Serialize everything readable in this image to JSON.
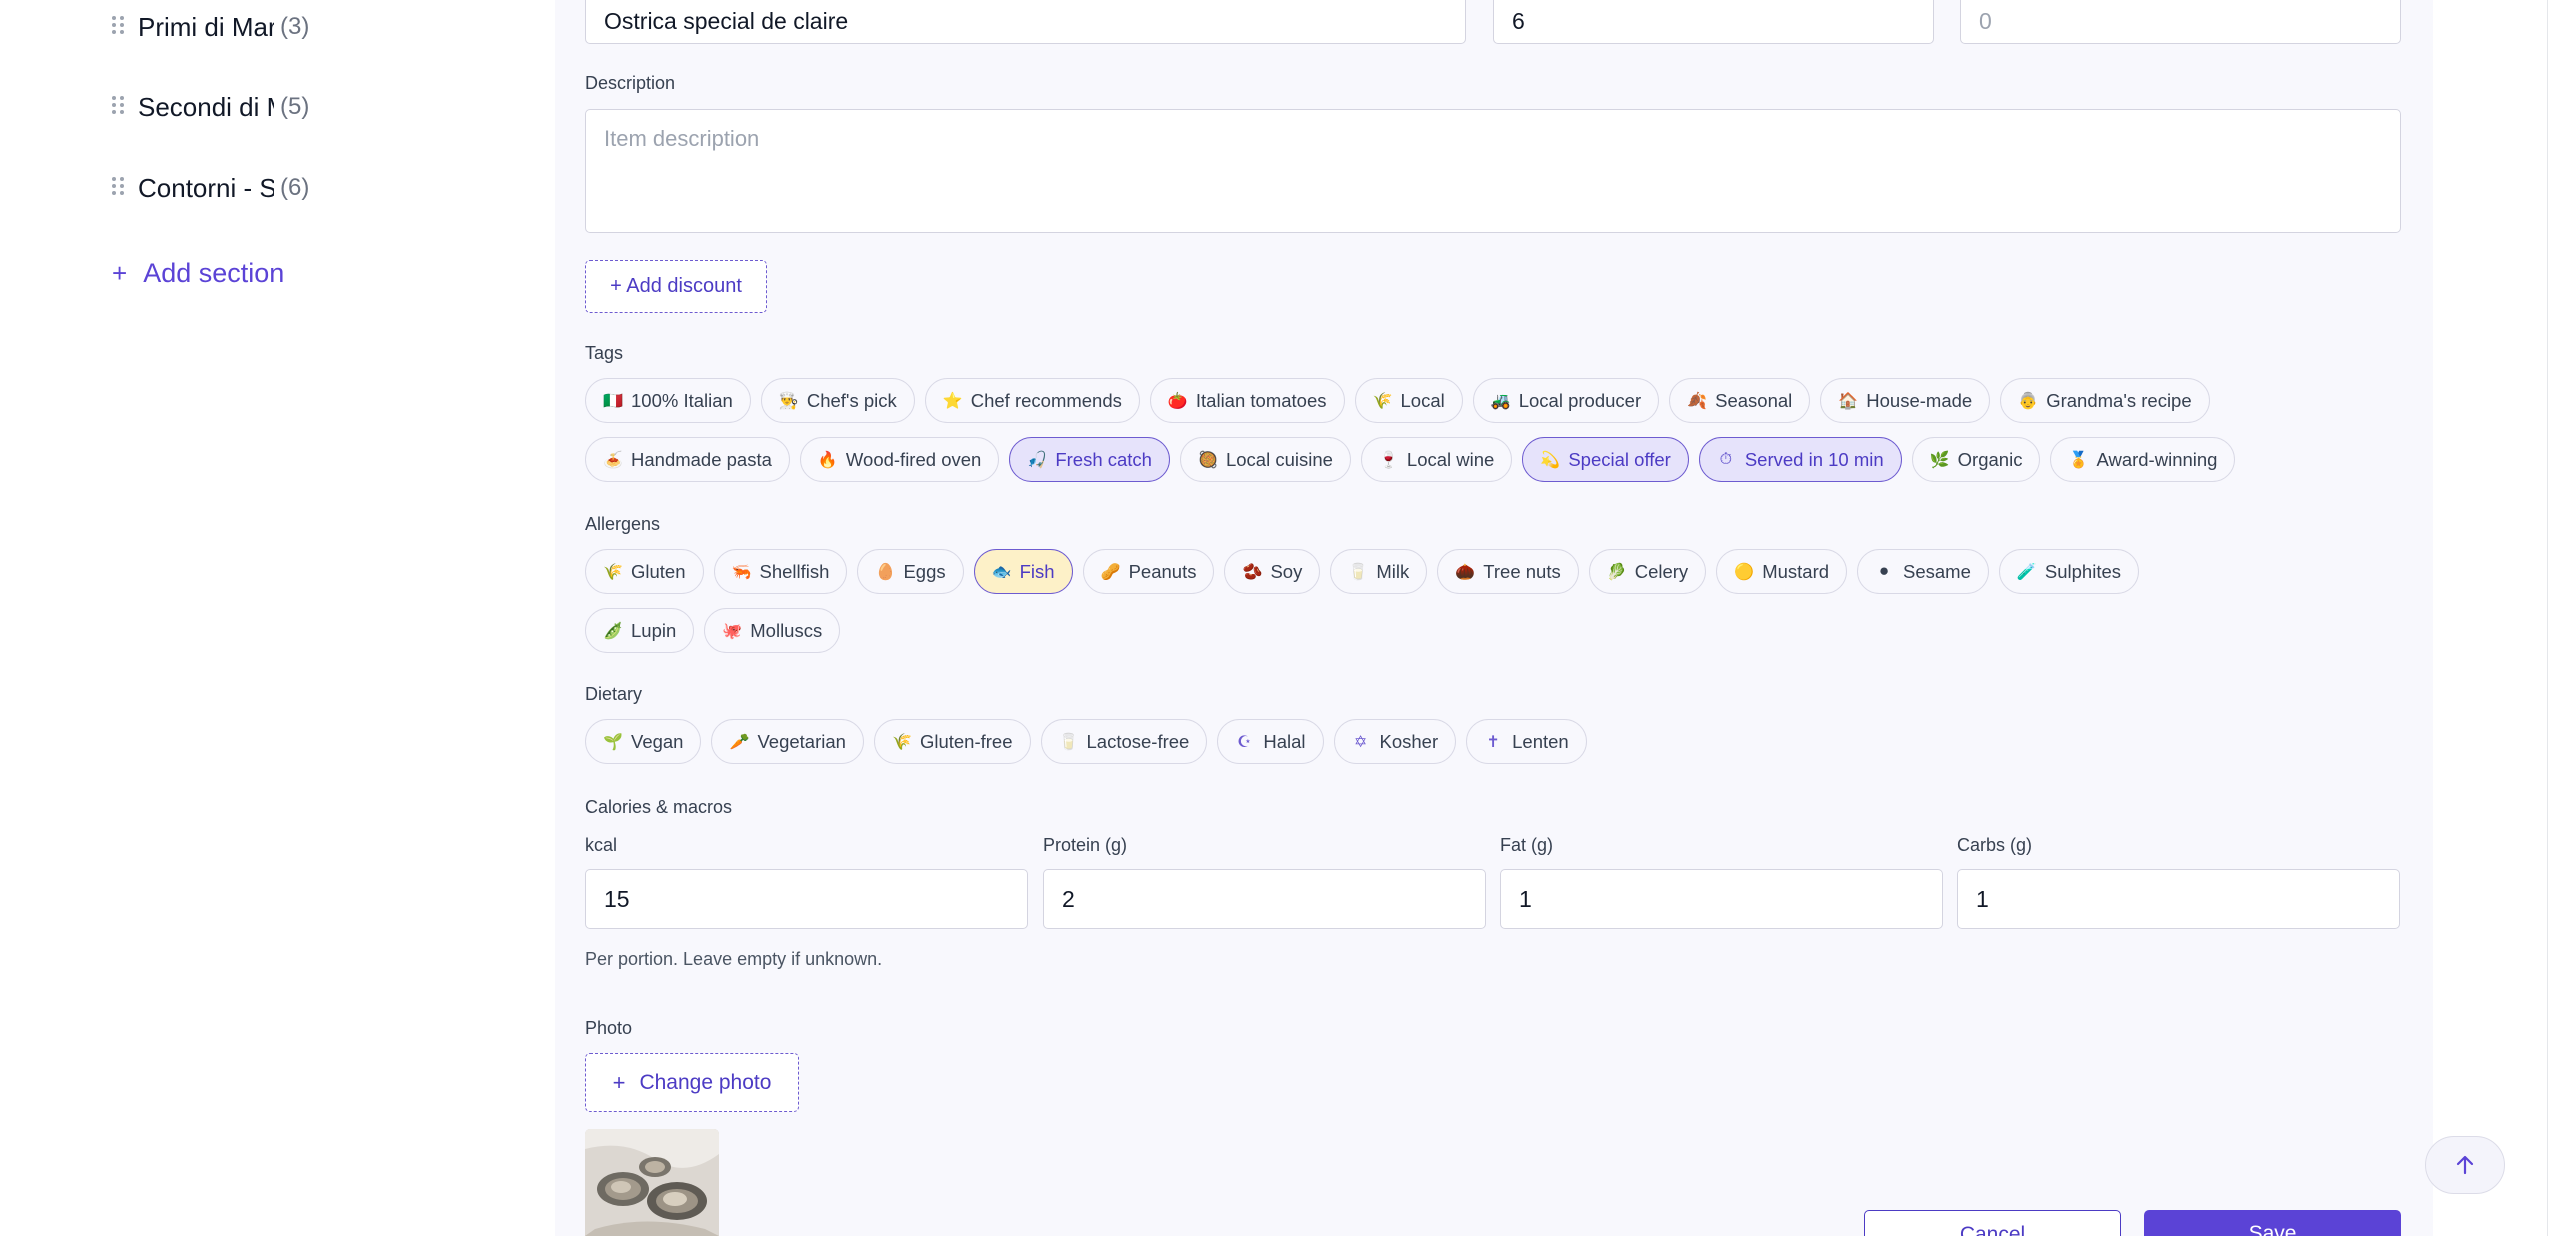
{
  "sidebar": {
    "sections": [
      {
        "name": "Primi di Mare",
        "count": "(3)"
      },
      {
        "name": "Secondi di Mare",
        "count": "(5)"
      },
      {
        "name": "Contorni - Side dishes",
        "count": "(6)"
      }
    ],
    "add_section_label": "Add section",
    "add_section_icon": "plus-icon"
  },
  "item": {
    "name_value": "Ostrica special de claire",
    "price_value": "6",
    "third_placeholder": "0",
    "description_label": "Description",
    "description_placeholder": "Item description",
    "add_discount_label": "+ Add discount"
  },
  "tags": {
    "label": "Tags",
    "row1": [
      {
        "emoji": "🇮🇹",
        "label": "100% Italian"
      },
      {
        "emoji": "👨‍🍳",
        "label": "Chef's pick"
      },
      {
        "emoji": "⭐",
        "label": "Chef recommends"
      },
      {
        "emoji": "🍅",
        "label": "Italian tomatoes"
      },
      {
        "emoji": "🌾",
        "label": "Local"
      },
      {
        "emoji": "🚜",
        "label": "Local producer"
      },
      {
        "emoji": "🍂",
        "label": "Seasonal"
      },
      {
        "emoji": "🏠",
        "label": "House-made"
      },
      {
        "emoji": "👵",
        "label": "Grandma's recipe"
      }
    ],
    "row2": [
      {
        "emoji": "🍝",
        "label": "Handmade pasta",
        "selected": false
      },
      {
        "emoji": "🔥",
        "label": "Wood-fired oven",
        "selected": false
      },
      {
        "emoji": "🎣",
        "label": "Fresh catch",
        "selected": true
      },
      {
        "emoji": "🥘",
        "label": "Local cuisine",
        "selected": false
      },
      {
        "emoji": "🍷",
        "label": "Local wine",
        "selected": false
      },
      {
        "emoji": "💫",
        "label": "Special offer",
        "selected": true
      },
      {
        "emoji": "⏱",
        "label": "Served in 10 min",
        "selected": true
      },
      {
        "emoji": "🌿",
        "label": "Organic",
        "selected": false
      },
      {
        "emoji": "🏅",
        "label": "Award-winning",
        "selected": false
      }
    ]
  },
  "allergens": {
    "label": "Allergens",
    "row1": [
      {
        "emoji": "🌾",
        "label": "Gluten",
        "selected": false
      },
      {
        "emoji": "🦐",
        "label": "Shellfish",
        "selected": false
      },
      {
        "emoji": "🥚",
        "label": "Eggs",
        "selected": false
      },
      {
        "emoji": "🐟",
        "label": "Fish",
        "selected": true
      },
      {
        "emoji": "🥜",
        "label": "Peanuts",
        "selected": false
      },
      {
        "emoji": "🫘",
        "label": "Soy",
        "selected": false
      },
      {
        "emoji": "🥛",
        "label": "Milk",
        "selected": false
      },
      {
        "emoji": "🌰",
        "label": "Tree nuts",
        "selected": false
      },
      {
        "emoji": "🥬",
        "label": "Celery",
        "selected": false
      },
      {
        "emoji": "🟡",
        "label": "Mustard",
        "selected": false
      },
      {
        "emoji": "⚫",
        "label": "Sesame",
        "selected": false
      },
      {
        "emoji": "🧪",
        "label": "Sulphites",
        "selected": false
      }
    ],
    "row2": [
      {
        "emoji": "🫛",
        "label": "Lupin",
        "selected": false
      },
      {
        "emoji": "🐙",
        "label": "Molluscs",
        "selected": false
      }
    ]
  },
  "dietary": {
    "label": "Dietary",
    "items": [
      {
        "emoji": "🌱",
        "label": "Vegan"
      },
      {
        "emoji": "🥕",
        "label": "Vegetarian"
      },
      {
        "emoji": "🌾",
        "label": "Gluten-free"
      },
      {
        "emoji": "🥛",
        "label": "Lactose-free"
      },
      {
        "emoji": "☪",
        "label": "Halal"
      },
      {
        "emoji": "✡",
        "label": "Kosher"
      },
      {
        "emoji": "✝",
        "label": "Lenten"
      }
    ]
  },
  "macros": {
    "label": "Calories & macros",
    "kcal_label": "kcal",
    "kcal_value": "15",
    "protein_label": "Protein (g)",
    "protein_value": "2",
    "fat_label": "Fat (g)",
    "fat_value": "1",
    "carbs_label": "Carbs (g)",
    "carbs_value": "1",
    "hint": "Per portion. Leave empty if unknown."
  },
  "photo": {
    "label": "Photo",
    "change_label": "Change photo",
    "change_icon": "plus-icon"
  },
  "actions": {
    "cancel_label": "Cancel",
    "save_label": "Save",
    "scroll_top_icon": "arrow-up-icon"
  },
  "colors": {
    "accent": "#5b43d6",
    "panel_bg": "#f8f8fd",
    "selected_tag_bg": "#e6e3fb",
    "selected_allergen_bg": "#fdf1c8"
  }
}
